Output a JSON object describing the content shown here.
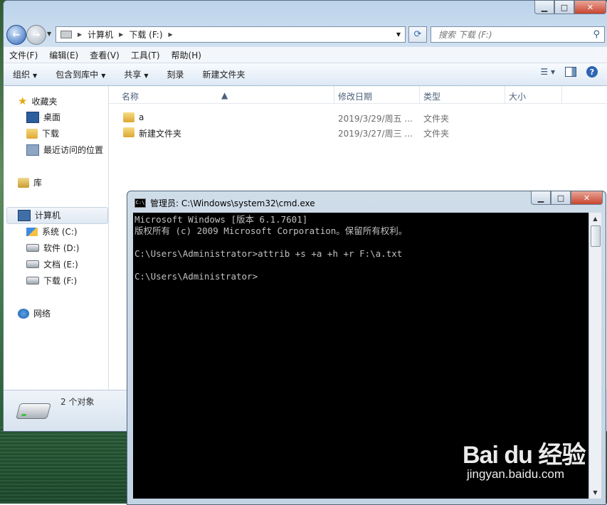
{
  "explorer": {
    "nav": {
      "breadcrumb": [
        "计算机",
        "下载 (F:)"
      ]
    },
    "search": {
      "placeholder": "搜索 下载 (F:)"
    },
    "menu": [
      "文件(F)",
      "编辑(E)",
      "查看(V)",
      "工具(T)",
      "帮助(H)"
    ],
    "toolbar": {
      "organize": "组织",
      "include_library": "包含到库中",
      "share": "共享",
      "burn": "刻录",
      "new_folder": "新建文件夹"
    },
    "sidebar": {
      "favorites": "收藏夹",
      "desktop": "桌面",
      "downloads": "下载",
      "recent": "最近访问的位置",
      "libraries": "库",
      "computer": "计算机",
      "drives": [
        "系统 (C:)",
        "软件 (D:)",
        "文档 (E:)",
        "下载 (F:)"
      ],
      "network": "网络"
    },
    "columns": {
      "name": "名称",
      "modified": "修改日期",
      "type": "类型",
      "size": "大小"
    },
    "files": [
      {
        "name": "a",
        "date": "2019/3/29/周五 ...",
        "type": "文件夹"
      },
      {
        "name": "新建文件夹",
        "date": "2019/3/27/周三 ...",
        "type": "文件夹"
      }
    ],
    "status": {
      "count": "2 个对象"
    }
  },
  "cmd": {
    "title": "管理员: C:\\Windows\\system32\\cmd.exe",
    "output": "Microsoft Windows [版本 6.1.7601]\n版权所有 (c) 2009 Microsoft Corporation。保留所有权利。\n\nC:\\Users\\Administrator>attrib +s +a +h +r F:\\a.txt\n\nC:\\Users\\Administrator>"
  },
  "watermark": {
    "logo": "Bai du 经验",
    "url": "jingyan.baidu.com"
  }
}
